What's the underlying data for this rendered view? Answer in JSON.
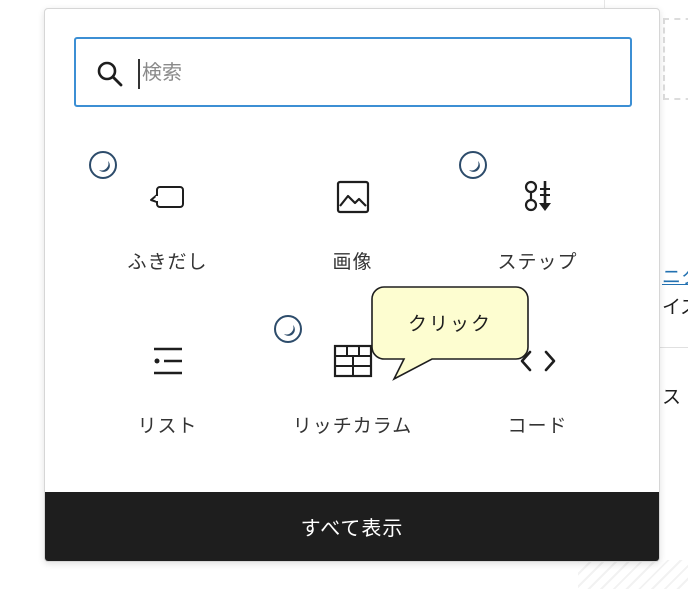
{
  "search": {
    "placeholder": "検索",
    "icon": "search-icon"
  },
  "blocks": [
    {
      "label": "ふきだし",
      "icon": "balloon-icon",
      "badge": true
    },
    {
      "label": "画像",
      "icon": "image-icon",
      "badge": false
    },
    {
      "label": "ステップ",
      "icon": "step-icon",
      "badge": true
    },
    {
      "label": "リスト",
      "icon": "list-icon",
      "badge": false
    },
    {
      "label": "リッチカラム",
      "icon": "rich-column-icon",
      "badge": true
    },
    {
      "label": "コード",
      "icon": "code-icon",
      "badge": false
    }
  ],
  "footer": {
    "browse_all_label": "すべて表示"
  },
  "callout": {
    "text": "クリック"
  },
  "background": {
    "link_fragment": "ニク",
    "text_fragment_1": "イズ",
    "text_fragment_2": "ス"
  },
  "colors": {
    "accent": "#3c8fd4",
    "footer_bg": "#1e1e1e",
    "badge_border": "#2d4c6b",
    "callout_bg": "#fdfdd0"
  }
}
